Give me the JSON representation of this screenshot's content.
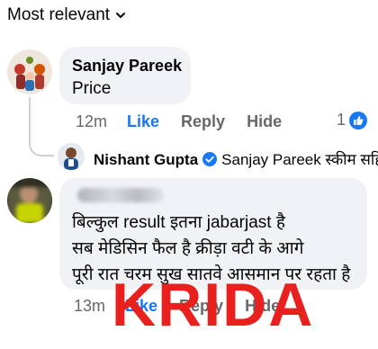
{
  "sort_menu": {
    "label": "Most relevant",
    "icon": "chevron-down-icon"
  },
  "comment1": {
    "author": "Sanjay Pareek",
    "text": "Price",
    "time": "12m",
    "like_label": "Like",
    "reply_label": "Reply",
    "hide_label": "Hide",
    "like_count": "1"
  },
  "reply1": {
    "author": "Nishant Gupta",
    "verified": true,
    "preview": "Sanjay Pareek स्कीम सहि..."
  },
  "comment2": {
    "lines": [
      "बिल्कुल result इतना jabarjast है",
      "सब मेडिसिन फैल है क्रीड़ा वटी के आगे",
      "पूरी रात चरम सुख सातवे आसमान पर रहता है"
    ],
    "time": "13m",
    "like_label": "Like",
    "reply_label": "Reply",
    "hide_label": "Hide"
  },
  "watermark": {
    "text": "KRIDA",
    "color": "#e8201e"
  },
  "colors": {
    "link_blue": "#1877f2",
    "bubble_bg": "#f0f2f5",
    "meta_gray": "#65676b"
  }
}
